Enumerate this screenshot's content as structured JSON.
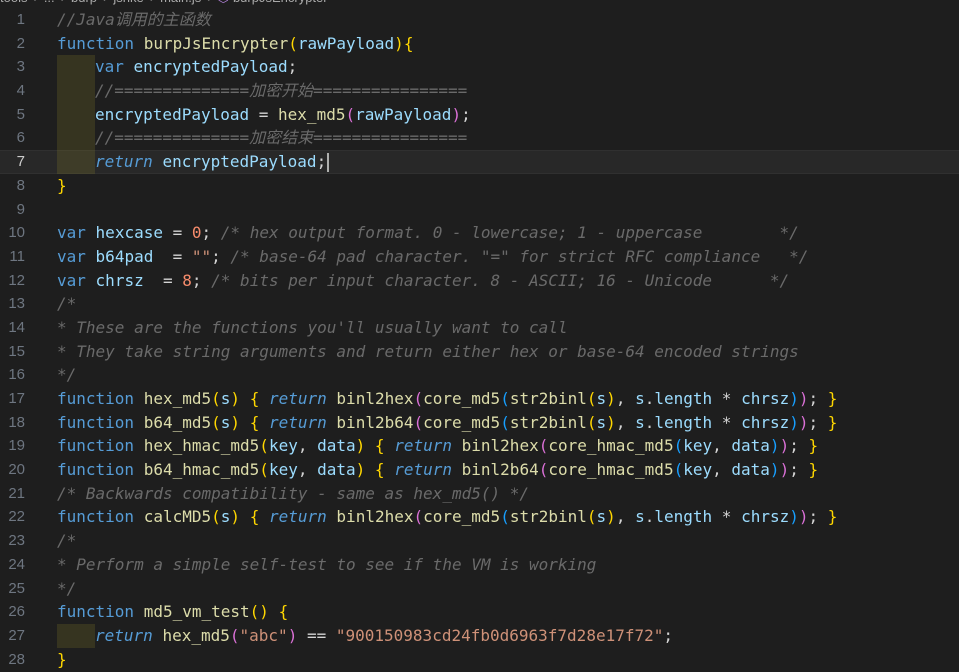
{
  "breadcrumb": {
    "parts": [
      "tools",
      "...",
      "burp",
      "jsrike",
      "main.js"
    ],
    "symbol": "burpJsEncrypter"
  },
  "lines": [
    {
      "num": "1",
      "current": false,
      "indent": 0,
      "tokens": [
        [
          "cmt",
          "//Java调用的主函数"
        ]
      ]
    },
    {
      "num": "2",
      "current": false,
      "indent": 0,
      "tokens": [
        [
          "kw",
          "function"
        ],
        [
          "op",
          " "
        ],
        [
          "fnname",
          "burpJsEncrypter"
        ],
        [
          "p1",
          "("
        ],
        [
          "param",
          "rawPayload"
        ],
        [
          "p1",
          ")"
        ],
        [
          "p1",
          "{"
        ]
      ]
    },
    {
      "num": "3",
      "current": false,
      "indent": 1,
      "tokens": [
        [
          "kw",
          "var"
        ],
        [
          "op",
          " "
        ],
        [
          "var",
          "encryptedPayload"
        ],
        [
          "op",
          ";"
        ]
      ]
    },
    {
      "num": "4",
      "current": false,
      "indent": 1,
      "tokens": [
        [
          "cmt",
          "//==============加密开始================"
        ]
      ]
    },
    {
      "num": "5",
      "current": false,
      "indent": 1,
      "tokens": [
        [
          "var",
          "encryptedPayload"
        ],
        [
          "op",
          " = "
        ],
        [
          "fnname",
          "hex_md5"
        ],
        [
          "p2",
          "("
        ],
        [
          "param",
          "rawPayload"
        ],
        [
          "p2",
          ")"
        ],
        [
          "op",
          ";"
        ]
      ]
    },
    {
      "num": "6",
      "current": false,
      "indent": 1,
      "tokens": [
        [
          "cmt",
          "//==============加密结束================"
        ]
      ]
    },
    {
      "num": "7",
      "current": true,
      "indent": 1,
      "tokens": [
        [
          "ctrl",
          "return"
        ],
        [
          "op",
          " "
        ],
        [
          "var",
          "encryptedPayload"
        ],
        [
          "op",
          ";"
        ]
      ]
    },
    {
      "num": "8",
      "current": false,
      "indent": 0,
      "tokens": [
        [
          "p1",
          "}"
        ]
      ]
    },
    {
      "num": "9",
      "current": false,
      "indent": 0,
      "tokens": []
    },
    {
      "num": "10",
      "current": false,
      "indent": 0,
      "tokens": [
        [
          "kw",
          "var"
        ],
        [
          "op",
          " "
        ],
        [
          "var",
          "hexcase"
        ],
        [
          "op",
          " = "
        ],
        [
          "num",
          "0"
        ],
        [
          "op",
          "; "
        ],
        [
          "cmt",
          "/* hex output format. 0 - lowercase; 1 - uppercase        */"
        ]
      ]
    },
    {
      "num": "11",
      "current": false,
      "indent": 0,
      "tokens": [
        [
          "kw",
          "var"
        ],
        [
          "op",
          " "
        ],
        [
          "var",
          "b64pad"
        ],
        [
          "op",
          "  = "
        ],
        [
          "str",
          "\"\""
        ],
        [
          "op",
          "; "
        ],
        [
          "cmt",
          "/* base-64 pad character. \"=\" for strict RFC compliance   */"
        ]
      ]
    },
    {
      "num": "12",
      "current": false,
      "indent": 0,
      "tokens": [
        [
          "kw",
          "var"
        ],
        [
          "op",
          " "
        ],
        [
          "var",
          "chrsz"
        ],
        [
          "op",
          "  = "
        ],
        [
          "num",
          "8"
        ],
        [
          "op",
          "; "
        ],
        [
          "cmt",
          "/* bits per input character. 8 - ASCII; 16 - Unicode      */"
        ]
      ]
    },
    {
      "num": "13",
      "current": false,
      "indent": 0,
      "tokens": [
        [
          "cmt",
          "/*"
        ]
      ]
    },
    {
      "num": "14",
      "current": false,
      "indent": 0,
      "tokens": [
        [
          "cmt",
          "* These are the functions you'll usually want to call"
        ]
      ]
    },
    {
      "num": "15",
      "current": false,
      "indent": 0,
      "tokens": [
        [
          "cmt",
          "* They take string arguments and return either hex or base-64 encoded strings"
        ]
      ]
    },
    {
      "num": "16",
      "current": false,
      "indent": 0,
      "tokens": [
        [
          "cmt",
          "*/"
        ]
      ]
    },
    {
      "num": "17",
      "current": false,
      "indent": 0,
      "tokens": [
        [
          "kw",
          "function"
        ],
        [
          "op",
          " "
        ],
        [
          "fnname",
          "hex_md5"
        ],
        [
          "p1",
          "("
        ],
        [
          "param",
          "s"
        ],
        [
          "p1",
          ")"
        ],
        [
          "op",
          " "
        ],
        [
          "p1",
          "{"
        ],
        [
          "op",
          " "
        ],
        [
          "ctrl",
          "return"
        ],
        [
          "op",
          " "
        ],
        [
          "fnname",
          "binl2hex"
        ],
        [
          "p2",
          "("
        ],
        [
          "fnname",
          "core_md5"
        ],
        [
          "p3",
          "("
        ],
        [
          "fnname",
          "str2binl"
        ],
        [
          "p1",
          "("
        ],
        [
          "param",
          "s"
        ],
        [
          "p1",
          ")"
        ],
        [
          "op",
          ", "
        ],
        [
          "param",
          "s"
        ],
        [
          "op",
          "."
        ],
        [
          "var",
          "length"
        ],
        [
          "op",
          " * "
        ],
        [
          "var",
          "chrsz"
        ],
        [
          "p3",
          ")"
        ],
        [
          "p2",
          ")"
        ],
        [
          "op",
          "; "
        ],
        [
          "p1",
          "}"
        ]
      ]
    },
    {
      "num": "18",
      "current": false,
      "indent": 0,
      "tokens": [
        [
          "kw",
          "function"
        ],
        [
          "op",
          " "
        ],
        [
          "fnname",
          "b64_md5"
        ],
        [
          "p1",
          "("
        ],
        [
          "param",
          "s"
        ],
        [
          "p1",
          ")"
        ],
        [
          "op",
          " "
        ],
        [
          "p1",
          "{"
        ],
        [
          "op",
          " "
        ],
        [
          "ctrl",
          "return"
        ],
        [
          "op",
          " "
        ],
        [
          "fnname",
          "binl2b64"
        ],
        [
          "p2",
          "("
        ],
        [
          "fnname",
          "core_md5"
        ],
        [
          "p3",
          "("
        ],
        [
          "fnname",
          "str2binl"
        ],
        [
          "p1",
          "("
        ],
        [
          "param",
          "s"
        ],
        [
          "p1",
          ")"
        ],
        [
          "op",
          ", "
        ],
        [
          "param",
          "s"
        ],
        [
          "op",
          "."
        ],
        [
          "var",
          "length"
        ],
        [
          "op",
          " * "
        ],
        [
          "var",
          "chrsz"
        ],
        [
          "p3",
          ")"
        ],
        [
          "p2",
          ")"
        ],
        [
          "op",
          "; "
        ],
        [
          "p1",
          "}"
        ]
      ]
    },
    {
      "num": "19",
      "current": false,
      "indent": 0,
      "tokens": [
        [
          "kw",
          "function"
        ],
        [
          "op",
          " "
        ],
        [
          "fnname",
          "hex_hmac_md5"
        ],
        [
          "p1",
          "("
        ],
        [
          "param",
          "key"
        ],
        [
          "op",
          ", "
        ],
        [
          "param",
          "data"
        ],
        [
          "p1",
          ")"
        ],
        [
          "op",
          " "
        ],
        [
          "p1",
          "{"
        ],
        [
          "op",
          " "
        ],
        [
          "ctrl",
          "return"
        ],
        [
          "op",
          " "
        ],
        [
          "fnname",
          "binl2hex"
        ],
        [
          "p2",
          "("
        ],
        [
          "fnname",
          "core_hmac_md5"
        ],
        [
          "p3",
          "("
        ],
        [
          "param",
          "key"
        ],
        [
          "op",
          ", "
        ],
        [
          "param",
          "data"
        ],
        [
          "p3",
          ")"
        ],
        [
          "p2",
          ")"
        ],
        [
          "op",
          "; "
        ],
        [
          "p1",
          "}"
        ]
      ]
    },
    {
      "num": "20",
      "current": false,
      "indent": 0,
      "tokens": [
        [
          "kw",
          "function"
        ],
        [
          "op",
          " "
        ],
        [
          "fnname",
          "b64_hmac_md5"
        ],
        [
          "p1",
          "("
        ],
        [
          "param",
          "key"
        ],
        [
          "op",
          ", "
        ],
        [
          "param",
          "data"
        ],
        [
          "p1",
          ")"
        ],
        [
          "op",
          " "
        ],
        [
          "p1",
          "{"
        ],
        [
          "op",
          " "
        ],
        [
          "ctrl",
          "return"
        ],
        [
          "op",
          " "
        ],
        [
          "fnname",
          "binl2b64"
        ],
        [
          "p2",
          "("
        ],
        [
          "fnname",
          "core_hmac_md5"
        ],
        [
          "p3",
          "("
        ],
        [
          "param",
          "key"
        ],
        [
          "op",
          ", "
        ],
        [
          "param",
          "data"
        ],
        [
          "p3",
          ")"
        ],
        [
          "p2",
          ")"
        ],
        [
          "op",
          "; "
        ],
        [
          "p1",
          "}"
        ]
      ]
    },
    {
      "num": "21",
      "current": false,
      "indent": 0,
      "tokens": [
        [
          "cmt",
          "/* Backwards compatibility - same as hex_md5() */"
        ]
      ]
    },
    {
      "num": "22",
      "current": false,
      "indent": 0,
      "tokens": [
        [
          "kw",
          "function"
        ],
        [
          "op",
          " "
        ],
        [
          "fnname",
          "calcMD5"
        ],
        [
          "p1",
          "("
        ],
        [
          "param",
          "s"
        ],
        [
          "p1",
          ")"
        ],
        [
          "op",
          " "
        ],
        [
          "p1",
          "{"
        ],
        [
          "op",
          " "
        ],
        [
          "ctrl",
          "return"
        ],
        [
          "op",
          " "
        ],
        [
          "fnname",
          "binl2hex"
        ],
        [
          "p2",
          "("
        ],
        [
          "fnname",
          "core_md5"
        ],
        [
          "p3",
          "("
        ],
        [
          "fnname",
          "str2binl"
        ],
        [
          "p1",
          "("
        ],
        [
          "param",
          "s"
        ],
        [
          "p1",
          ")"
        ],
        [
          "op",
          ", "
        ],
        [
          "param",
          "s"
        ],
        [
          "op",
          "."
        ],
        [
          "var",
          "length"
        ],
        [
          "op",
          " * "
        ],
        [
          "var",
          "chrsz"
        ],
        [
          "p3",
          ")"
        ],
        [
          "p2",
          ")"
        ],
        [
          "op",
          "; "
        ],
        [
          "p1",
          "}"
        ]
      ]
    },
    {
      "num": "23",
      "current": false,
      "indent": 0,
      "tokens": [
        [
          "cmt",
          "/*"
        ]
      ]
    },
    {
      "num": "24",
      "current": false,
      "indent": 0,
      "tokens": [
        [
          "cmt",
          "* Perform a simple self-test to see if the VM is working"
        ]
      ]
    },
    {
      "num": "25",
      "current": false,
      "indent": 0,
      "tokens": [
        [
          "cmt",
          "*/"
        ]
      ]
    },
    {
      "num": "26",
      "current": false,
      "indent": 0,
      "tokens": [
        [
          "kw",
          "function"
        ],
        [
          "op",
          " "
        ],
        [
          "fnname",
          "md5_vm_test"
        ],
        [
          "p1",
          "()"
        ],
        [
          "op",
          " "
        ],
        [
          "p1",
          "{"
        ]
      ]
    },
    {
      "num": "27",
      "current": false,
      "indent": 1,
      "tokens": [
        [
          "ctrl",
          "return"
        ],
        [
          "op",
          " "
        ],
        [
          "fnname",
          "hex_md5"
        ],
        [
          "p2",
          "("
        ],
        [
          "str",
          "\"abc\""
        ],
        [
          "p2",
          ")"
        ],
        [
          "op",
          " == "
        ],
        [
          "str",
          "\"900150983cd24fb0d6963f7d28e17f72\""
        ],
        [
          "op",
          ";"
        ]
      ]
    },
    {
      "num": "28",
      "current": false,
      "indent": 0,
      "tokens": [
        [
          "p1",
          "}"
        ]
      ]
    }
  ]
}
